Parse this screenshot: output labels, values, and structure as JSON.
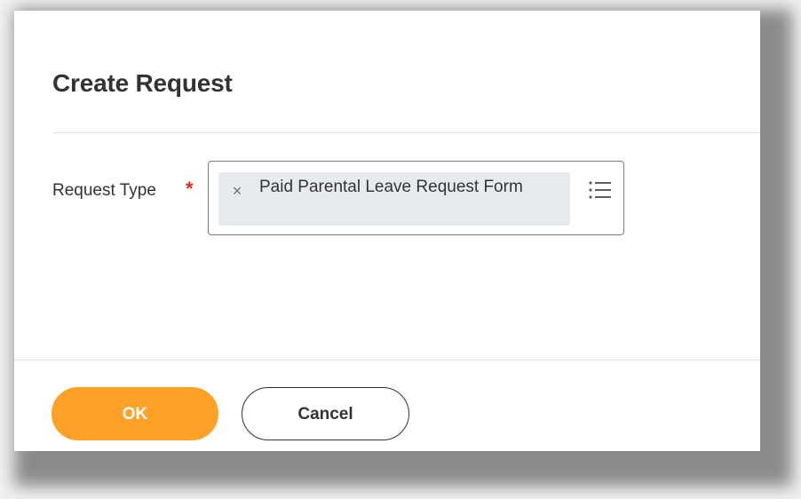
{
  "dialog": {
    "title": "Create Request",
    "request_type": {
      "label": "Request Type",
      "required_marker": "*",
      "selected_value": "Paid Parental Leave Request Form",
      "remove_glyph": "×",
      "list_icon": "list-icon"
    },
    "buttons": {
      "ok_label": "OK",
      "cancel_label": "Cancel"
    }
  },
  "colors": {
    "primary_button": "#ffa126",
    "required": "#de2e21",
    "pill_background": "#e8ebee",
    "text": "#333333"
  }
}
